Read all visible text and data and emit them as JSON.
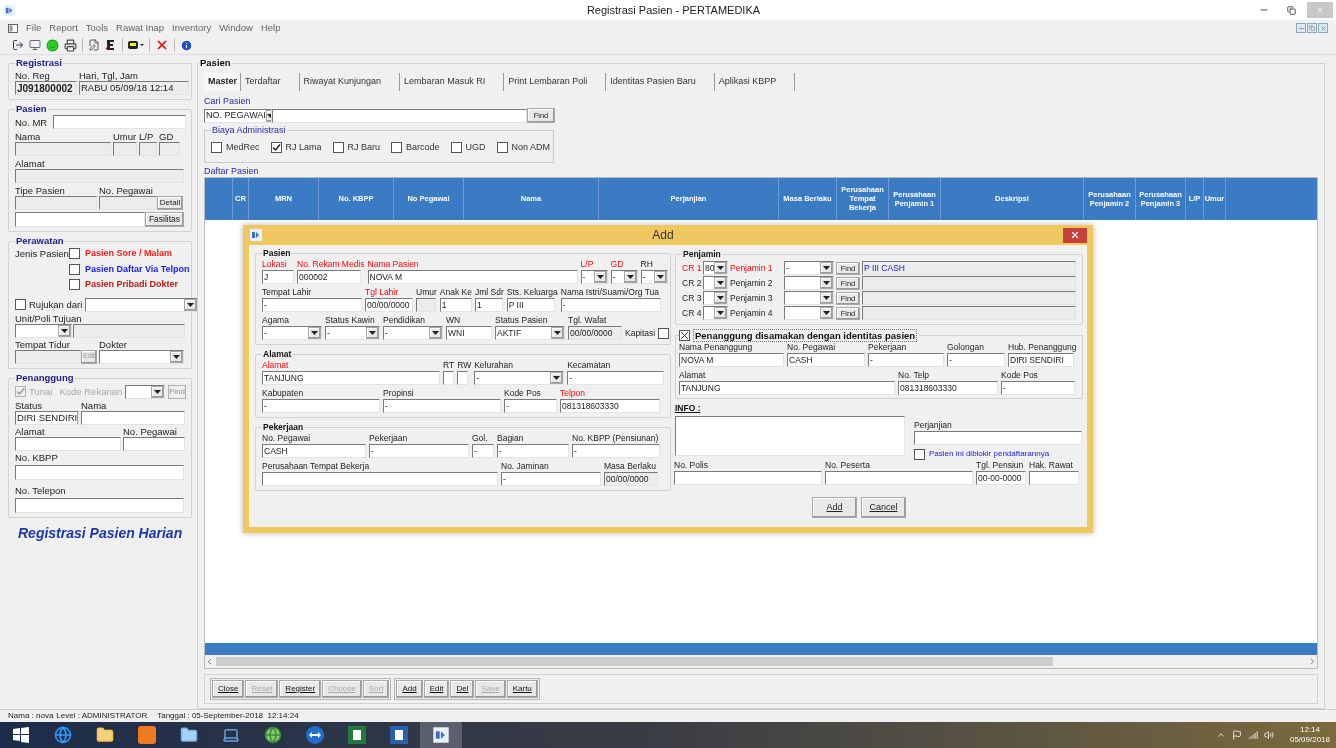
{
  "window": {
    "title": "Registrasi Pasien - PERTAMEDIKA"
  },
  "menu": [
    "File",
    "Report",
    "Tools",
    "Rawat Inap",
    "Inventory",
    "Window",
    "Help"
  ],
  "registrasi": {
    "title": "Registrasi",
    "no_reg": {
      "label": "No. Reg",
      "value": "J091800002"
    },
    "hari": {
      "label": "Hari, Tgl, Jam",
      "value": "RABU 05/09/18 12:14"
    }
  },
  "pasien_left": {
    "title": "Pasien",
    "no_mr": "No. MR",
    "nama": "Nama",
    "umur": "Umur",
    "lp": "L/P",
    "gd": "GD",
    "alamat": "Alamat",
    "tipe": "Tipe Pasien",
    "no_pegawai": "No. Pegawai",
    "detail_button": "Detail",
    "fasilitas_button": "Fasilitas"
  },
  "perawatan": {
    "title": "Perawatan",
    "jenis_label": "Jenis Pasien",
    "options": [
      {
        "label": "Pasien Sore / Malam",
        "checked": false,
        "color": "#ff1a1a"
      },
      {
        "label": "Pasien Daftar Via Telpon",
        "checked": false,
        "color": "#1a1aff"
      },
      {
        "label": "Pasien Pribadi Dokter",
        "checked": false,
        "color": "#c01818"
      }
    ],
    "rujukan": {
      "label": "Rujukan dari",
      "checked": false
    },
    "unit": "Unit/Poli Tujuan",
    "tempat_tidur": "Tempat Tidur",
    "edit_button": "Edit",
    "dokter": "Dokter"
  },
  "penanggung": {
    "title": "Penanggung",
    "tunai": {
      "label": "Tunai",
      "checked": true,
      "disabled": true
    },
    "kode_rekanan": "Kode Rekanan",
    "find_button": "Find",
    "status_label": "Status",
    "status_value": "DIRI SENDIRI",
    "nama": "Nama",
    "alamat": "Alamat",
    "no_pegawai": "No. Pegawai",
    "no_kbpp": "No. KBPP",
    "no_telepon": "No. Telepon"
  },
  "banner": "Registrasi Pasien Harian",
  "main": {
    "title": "Pasien",
    "tabs": [
      {
        "label": "Master",
        "selected": true
      },
      {
        "label": "Terdaftar",
        "selected": false
      },
      {
        "label": "Riwayat Kunjungan",
        "selected": false
      },
      {
        "label": "Lembaran Masuk RI",
        "selected": false
      },
      {
        "label": "Print Lembaran Poli",
        "selected": false
      },
      {
        "label": "Identitas Pasien Baru",
        "selected": false
      },
      {
        "label": "Aplikasi KBPP",
        "selected": false
      }
    ],
    "cari_label": "Cari Pasien",
    "search_by": "NO. PEGAWAI",
    "find_button": "Find",
    "biaya": {
      "title": "Biaya Administrasi",
      "options": [
        {
          "label": "MedRec",
          "checked": false
        },
        {
          "label": "RJ Lama",
          "checked": true
        },
        {
          "label": "RJ Baru",
          "checked": false
        },
        {
          "label": "Barcode",
          "checked": false
        },
        {
          "label": "UGD",
          "checked": false
        },
        {
          "label": "Non ADM",
          "checked": false
        }
      ]
    },
    "daftar_label": "Daftar Pasien",
    "table": {
      "columns": [
        "CR",
        "MRN",
        "No. KBPP",
        "No Pegawai",
        "Nama",
        "Perjanjian",
        "Masa Berlaku",
        "Perusahaan Tempat Bekerja",
        "Perusahaan Penjamin 1",
        "Deskripsi",
        "Perusahaan Penjamin 2",
        "Perusahaan Penjamin 3",
        "L/P",
        "Umur"
      ]
    },
    "button_groups": [
      [
        {
          "label": "Close",
          "disabled": false
        },
        {
          "label": "Reset",
          "disabled": true
        },
        {
          "label": "Register",
          "disabled": false
        },
        {
          "label": "Choose",
          "disabled": true
        },
        {
          "label": "Sort",
          "disabled": true
        }
      ],
      [
        {
          "label": "Add",
          "disabled": false
        },
        {
          "label": "Edit",
          "disabled": false
        },
        {
          "label": "Del",
          "disabled": false
        },
        {
          "label": "Save",
          "disabled": true
        },
        {
          "label": "Kartu",
          "disabled": false
        }
      ]
    ]
  },
  "dialog": {
    "title": "Add",
    "pasien": {
      "title": "Pasien",
      "lines": [
        {
          "fields": [
            {
              "label": "Lokasi",
              "value": "J",
              "kind": "text",
              "required": true
            },
            {
              "label": "No. Rekam Medis",
              "value": "000002",
              "kind": "text",
              "required": true
            },
            {
              "label": "Nama Pasien",
              "value": "NOVA M",
              "kind": "text",
              "required": true
            },
            {
              "label": "L/P",
              "value": "-",
              "kind": "combo",
              "required": true
            },
            {
              "label": "GD",
              "value": "-",
              "kind": "combo",
              "required": true
            },
            {
              "label": "RH",
              "value": "-",
              "kind": "combo",
              "required": false
            }
          ]
        },
        {
          "fields": [
            {
              "label": "Tempat Lahir",
              "value": "-",
              "kind": "text",
              "required": false
            },
            {
              "label": "Tgl Lahir",
              "value": "00/00/0000",
              "kind": "text",
              "required": true
            },
            {
              "label": "Umur",
              "kind": "readonly",
              "required": false
            },
            {
              "label": "Anak Ke",
              "value": "1",
              "kind": "text",
              "required": false
            },
            {
              "label": "Jml Sdr",
              "value": "1",
              "kind": "text",
              "required": false
            },
            {
              "label": "Sts. Keluarga",
              "value": "P III",
              "kind": "text",
              "required": false
            },
            {
              "label": "Nama Istri/Suami/Org Tua",
              "value": "-",
              "kind": "text",
              "required": false
            }
          ]
        },
        {
          "fields": [
            {
              "label": "Agama",
              "value": "-",
              "kind": "combo",
              "required": false
            },
            {
              "label": "Status Kawin",
              "value": "-",
              "kind": "combo",
              "required": false
            },
            {
              "label": "Pendidikan",
              "value": "-",
              "kind": "combo",
              "required": false
            },
            {
              "label": "WN",
              "value": "WNI",
              "kind": "text",
              "required": false
            },
            {
              "label": "Status Pasien",
              "value": "AKTIF",
              "kind": "combo",
              "required": false
            },
            {
              "label": "Tgl. Wafat",
              "value": "00/00/0000",
              "kind": "readonly",
              "required": false
            },
            {
              "label": "Kapitasi",
              "kind": "check",
              "checked": false,
              "required": false
            }
          ]
        }
      ]
    },
    "alamat": {
      "title": "Alamat",
      "lines": [
        {
          "fields": [
            {
              "label": "Alamat",
              "value": "TANJUNG",
              "kind": "text",
              "required": true
            },
            {
              "label": "RT",
              "kind": "text",
              "required": false
            },
            {
              "label": "RW",
              "kind": "text",
              "required": false
            },
            {
              "label": "Kelurahan",
              "value": "-",
              "kind": "combo",
              "required": false
            },
            {
              "label": "Kecamatan",
              "value": "-",
              "kind": "text",
              "required": false
            }
          ]
        },
        {
          "fields": [
            {
              "label": "Kabupaten",
              "value": "-",
              "kind": "text",
              "required": false
            },
            {
              "label": "Propinsi",
              "value": "-",
              "kind": "text",
              "required": false
            },
            {
              "label": "Kode Pos",
              "value": "-",
              "kind": "text",
              "required": false
            },
            {
              "label": "Telpon",
              "value": "081318603330",
              "kind": "text",
              "required": true
            }
          ]
        }
      ]
    },
    "pekerjaan": {
      "title": "Pekerjaan",
      "lines": [
        {
          "fields": [
            {
              "label": "No. Pegawai",
              "value": "CASH",
              "kind": "text",
              "required": false
            },
            {
              "label": "Pekerjaan",
              "value": "-",
              "kind": "text",
              "required": false
            },
            {
              "label": "Gol.",
              "value": "-",
              "kind": "text",
              "required": false
            },
            {
              "label": "Bagian",
              "value": "-",
              "kind": "text",
              "required": false
            },
            {
              "label": "No. KBPP (Pensiunan)",
              "value": "-",
              "kind": "text",
              "required": false
            }
          ]
        },
        {
          "fields": [
            {
              "label": "Perusahaan Tempat Bekerja",
              "kind": "text",
              "required": false
            },
            {
              "label": "No. Jaminan",
              "value": "-",
              "kind": "text",
              "required": false
            },
            {
              "label": "Masa Berlaku",
              "value": "00/00/0000",
              "kind": "readonly",
              "required": false
            }
          ]
        }
      ]
    },
    "penjamin": {
      "title": "Penjamin",
      "rows": [
        {
          "cr_label": "CR 1",
          "cr_value": "80",
          "label": "Penjamin 1",
          "value": "-",
          "required": true,
          "find_button": "Find",
          "result": "P III CASH"
        },
        {
          "cr_label": "CR 2",
          "label": "Penjamin 2",
          "required": false,
          "find_button": "Find"
        },
        {
          "cr_label": "CR 3",
          "label": "Penjamin 3",
          "required": false,
          "find_button": "Find"
        },
        {
          "cr_label": "CR 4",
          "label": "Penjamin 4",
          "required": false,
          "find_button": "Find"
        }
      ]
    },
    "penanggung": {
      "title": "Penanggung disamakan dengan identitas pasien",
      "checked": true,
      "lines": [
        {
          "fields": [
            {
              "label": "Nama Penanggung",
              "value": "NOVA M",
              "kind": "text",
              "required": false
            },
            {
              "label": "No. Pegawai",
              "value": "CASH",
              "kind": "text",
              "required": false
            },
            {
              "label": "Pekerjaan",
              "value": "-",
              "kind": "text",
              "required": false
            },
            {
              "label": "Golongan",
              "value": "-",
              "kind": "text",
              "required": false
            },
            {
              "label": "Hub. Penanggung",
              "value": "DIRI SENDIRI",
              "kind": "text",
              "required": false
            }
          ]
        },
        {
          "fields": [
            {
              "label": "Alamat",
              "value": "TANJUNG",
              "kind": "text",
              "required": false
            },
            {
              "label": "No. Telp",
              "value": "081318603330",
              "kind": "text",
              "required": false
            },
            {
              "label": "Kode Pos",
              "value": "-",
              "kind": "text",
              "required": false
            }
          ]
        }
      ]
    },
    "info": {
      "title": "INFO :",
      "perjanjian": {
        "label": "Perjanjian",
        "kind": "text",
        "required": false
      },
      "blokir": {
        "label": "Pasien ini diblokir pendaftarannya",
        "checked": false
      },
      "fields": [
        {
          "label": "No. Polis",
          "kind": "text",
          "required": false
        },
        {
          "label": "No. Peserta",
          "kind": "text",
          "required": false
        },
        {
          "label": "Tgl. Pensiun",
          "value": "00-00-0000",
          "kind": "text",
          "required": false
        },
        {
          "label": "Hak. Rawat",
          "kind": "text",
          "required": false
        }
      ]
    },
    "buttons": [
      "Add",
      "Cancel"
    ]
  },
  "status_bar": {
    "nama": "Nama : nova",
    "level": "Level : ADMINISTRATOR",
    "tanggal": "Tanggal : 05-September-2018  12:14:24"
  },
  "taskbar": {
    "time": "12:14",
    "date": "05/09/2018"
  }
}
